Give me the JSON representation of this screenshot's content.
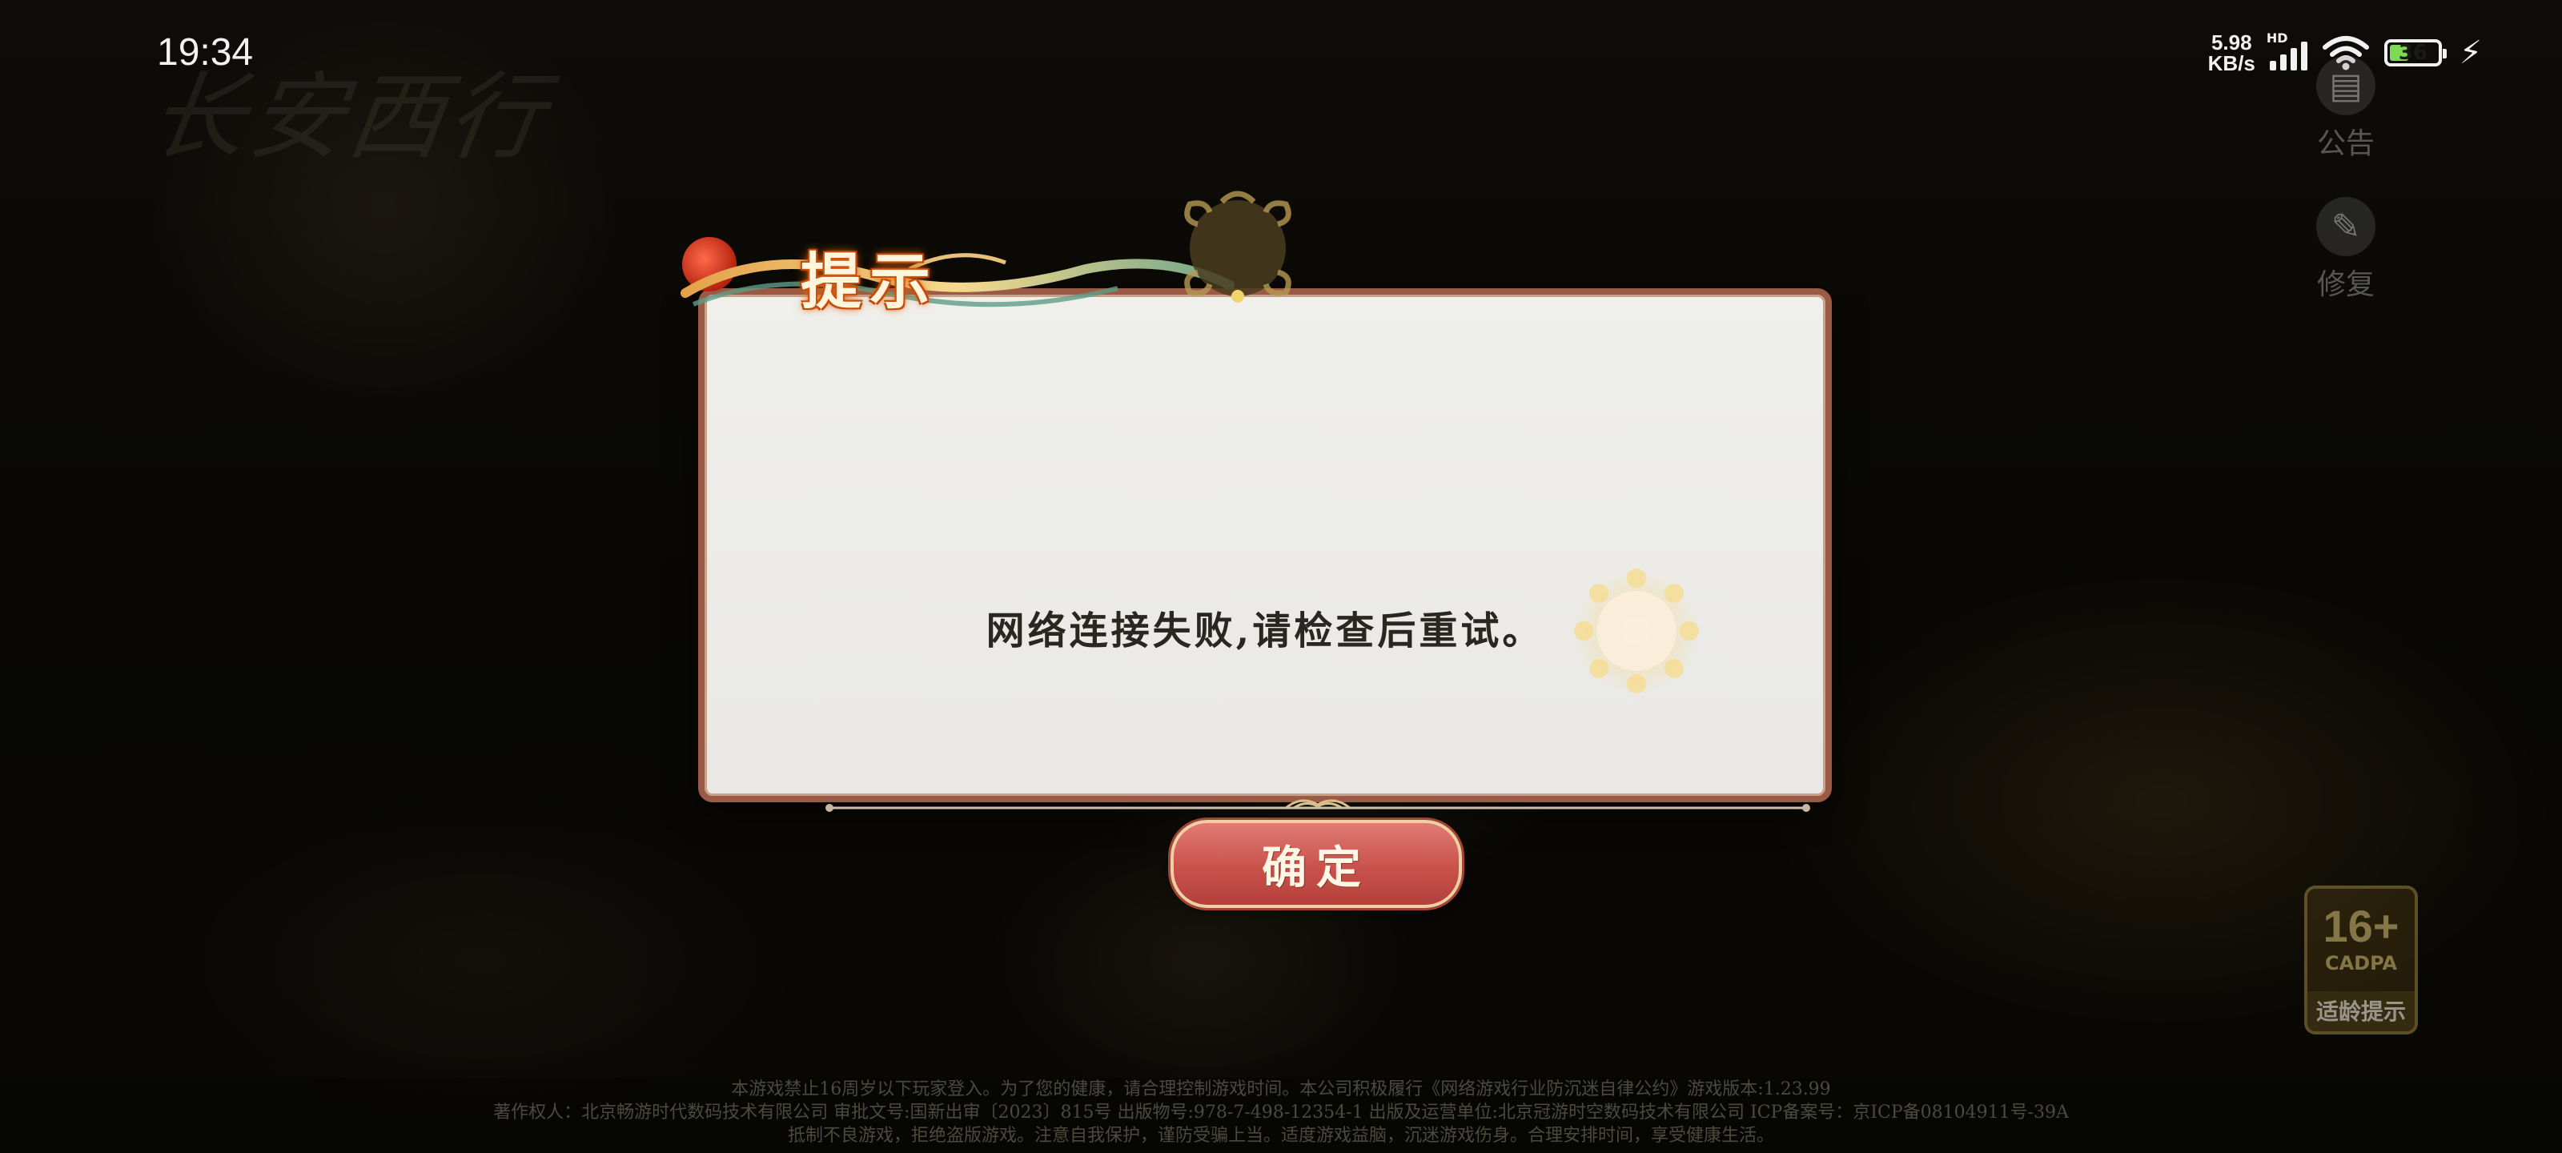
{
  "status_bar": {
    "time": "19:34",
    "net_speed_value": "5.98",
    "net_speed_unit": "KB/s",
    "signal_label": "HD",
    "battery_level": "36",
    "battery_color": "#7ed957"
  },
  "game": {
    "logo_text": "长安西行"
  },
  "side_buttons": {
    "notice_label": "公告",
    "repair_label": "修复"
  },
  "age_rating": {
    "age": "16+",
    "org": "CADPA",
    "tip": "适龄提示"
  },
  "dialog": {
    "title": "提示",
    "message": "网络连接失败,请检查后重试。",
    "confirm_label": "确定",
    "accent_color": "#9b5a45",
    "button_color": "#c9524b"
  },
  "footer": {
    "line1": "本游戏禁止16周岁以下玩家登入。为了您的健康，请合理控制游戏时间。本公司积极履行《网络游戏行业防沉迷自律公约》游戏版本:1.23.99",
    "line2": "著作权人：北京畅游时代数码技术有限公司 审批文号:国新出审〔2023〕815号 出版物号:978-7-498-12354-1 出版及运营单位:北京冠游时空数码技术有限公司 ICP备案号：京ICP备08104911号-39A",
    "line3": "抵制不良游戏，拒绝盗版游戏。注意自我保护，谨防受骗上当。适度游戏益脑，沉迷游戏伤身。合理安排时间，享受健康生活。"
  }
}
